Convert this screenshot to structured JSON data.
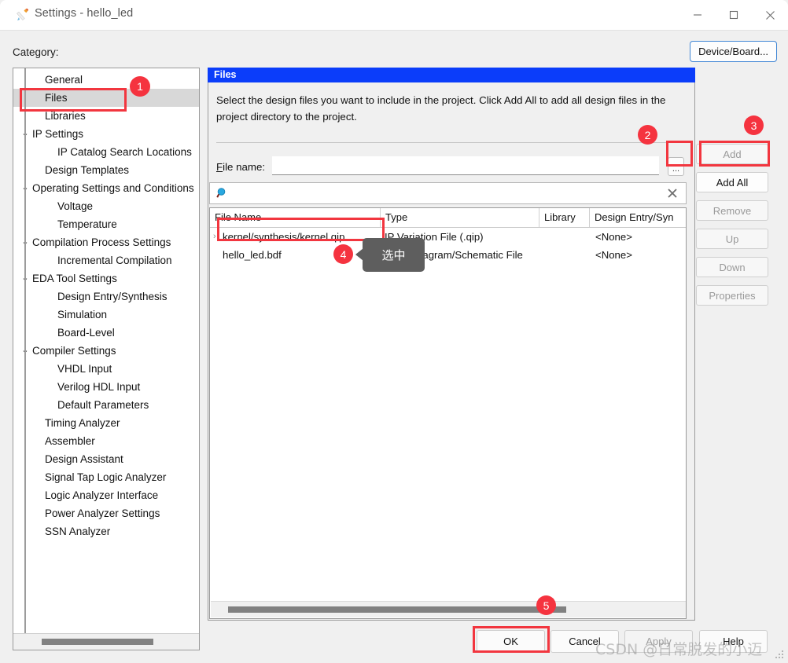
{
  "window": {
    "title": "Settings - hello_led",
    "icon": "pencil-icon",
    "controls": {
      "minimize": "—",
      "maximize": "□",
      "close": "✕"
    }
  },
  "toolbar": {
    "category_label": "Category:",
    "device_board_label": "Device/Board..."
  },
  "tree": {
    "items": [
      {
        "label": "General",
        "level": 0,
        "chevron": "",
        "selected": false
      },
      {
        "label": "Files",
        "level": 0,
        "chevron": "",
        "selected": true
      },
      {
        "label": "Libraries",
        "level": 0,
        "chevron": "",
        "selected": false
      },
      {
        "label": "IP Settings",
        "level": 0,
        "chevron": "⌄",
        "selected": false
      },
      {
        "label": "IP Catalog Search Locations",
        "level": 1,
        "chevron": "",
        "selected": false
      },
      {
        "label": "Design Templates",
        "level": 0,
        "chevron": "",
        "selected": false
      },
      {
        "label": "Operating Settings and Conditions",
        "level": 0,
        "chevron": "⌄",
        "selected": false
      },
      {
        "label": "Voltage",
        "level": 1,
        "chevron": "",
        "selected": false
      },
      {
        "label": "Temperature",
        "level": 1,
        "chevron": "",
        "selected": false
      },
      {
        "label": "Compilation Process Settings",
        "level": 0,
        "chevron": "⌄",
        "selected": false
      },
      {
        "label": "Incremental Compilation",
        "level": 1,
        "chevron": "",
        "selected": false
      },
      {
        "label": "EDA Tool Settings",
        "level": 0,
        "chevron": "⌄",
        "selected": false
      },
      {
        "label": "Design Entry/Synthesis",
        "level": 1,
        "chevron": "",
        "selected": false
      },
      {
        "label": "Simulation",
        "level": 1,
        "chevron": "",
        "selected": false
      },
      {
        "label": "Board-Level",
        "level": 1,
        "chevron": "",
        "selected": false
      },
      {
        "label": "Compiler Settings",
        "level": 0,
        "chevron": "⌄",
        "selected": false
      },
      {
        "label": "VHDL Input",
        "level": 1,
        "chevron": "",
        "selected": false
      },
      {
        "label": "Verilog HDL Input",
        "level": 1,
        "chevron": "",
        "selected": false
      },
      {
        "label": "Default Parameters",
        "level": 1,
        "chevron": "",
        "selected": false
      },
      {
        "label": "Timing Analyzer",
        "level": 0,
        "chevron": "",
        "selected": false
      },
      {
        "label": "Assembler",
        "level": 0,
        "chevron": "",
        "selected": false
      },
      {
        "label": "Design Assistant",
        "level": 0,
        "chevron": "",
        "selected": false
      },
      {
        "label": "Signal Tap Logic Analyzer",
        "level": 0,
        "chevron": "",
        "selected": false
      },
      {
        "label": "Logic Analyzer Interface",
        "level": 0,
        "chevron": "",
        "selected": false
      },
      {
        "label": "Power Analyzer Settings",
        "level": 0,
        "chevron": "",
        "selected": false
      },
      {
        "label": "SSN Analyzer",
        "level": 0,
        "chevron": "",
        "selected": false
      }
    ]
  },
  "panel": {
    "header": "Files",
    "description": "Select the design files you want to include in the project. Click Add All to add all design files in the project directory to the project.",
    "file_name_label_pre": "F",
    "file_name_label_post": "ile name:",
    "file_name_value": "",
    "file_name_placeholder": "",
    "browse_label": "...",
    "search_value": "",
    "search_placeholder": "",
    "search_icon": "magnifier-icon",
    "search_clear_icon": "clear-icon"
  },
  "table": {
    "columns": [
      {
        "label": "File Name"
      },
      {
        "label": "Type"
      },
      {
        "label": "Library"
      },
      {
        "label": "Design Entry/Syn"
      }
    ],
    "rows": [
      {
        "file_name": "kernel/synthesis/kernel.qip",
        "type": "IP Variation File (.qip)",
        "library": "",
        "design_entry": "<None>",
        "expandable": true,
        "chevron": "›"
      },
      {
        "file_name": "hello_led.bdf",
        "type": "Block Diagram/Schematic File",
        "library": "",
        "design_entry": "<None>",
        "expandable": false,
        "chevron": ""
      }
    ]
  },
  "side_buttons": [
    {
      "name": "add",
      "label_pre": "A",
      "label_u": "d",
      "label_post": "d",
      "plain": "Add",
      "enabled": false
    },
    {
      "name": "add-all",
      "label": "Add All",
      "enabled": true
    },
    {
      "name": "remove",
      "label": "Remove",
      "enabled": false
    },
    {
      "name": "up",
      "label": "Up",
      "enabled": false
    },
    {
      "name": "down",
      "label": "Down",
      "enabled": false
    },
    {
      "name": "properties",
      "label": "Properties",
      "enabled": false
    }
  ],
  "bottom_buttons": [
    {
      "name": "ok",
      "label": "OK",
      "enabled": true
    },
    {
      "name": "cancel",
      "label": "Cancel",
      "enabled": true
    },
    {
      "name": "apply",
      "label": "Apply",
      "enabled": false
    },
    {
      "name": "help",
      "label": "Help",
      "enabled": true
    }
  ],
  "annotations": {
    "badges": [
      "1",
      "2",
      "3",
      "4",
      "5"
    ],
    "tooltip_text": "选中",
    "highlight_color": "#f2363f",
    "badge_color": "#f5333f"
  },
  "watermark": {
    "text": "CSDN @日常脱发的小迈"
  }
}
